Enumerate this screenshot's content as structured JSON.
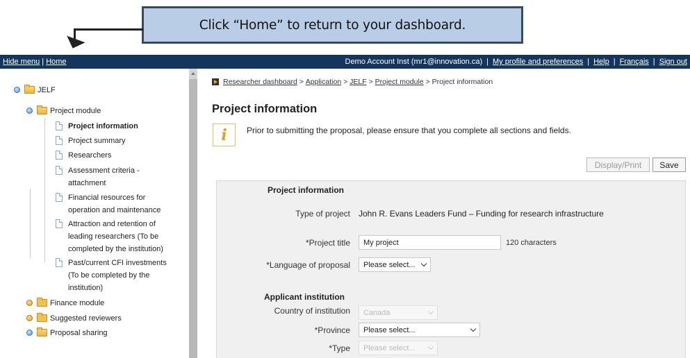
{
  "callout": {
    "text": "Click “Home” to return to your dashboard."
  },
  "topbar": {
    "hide_menu": "Hide menu",
    "divider": "|",
    "home": "Home",
    "account": "Demo Account Inst (mr1@innovation.ca)",
    "profile": "My profile and preferences",
    "help": "Help",
    "language": "Français",
    "sign_out": "Sign out"
  },
  "tree": {
    "root": "JELF",
    "project_module": "Project module",
    "items": [
      {
        "label": "Project information"
      },
      {
        "label": "Project summary"
      },
      {
        "label": "Researchers"
      },
      {
        "label_lines": [
          "Assessment criteria -",
          "attachment"
        ]
      },
      {
        "label_lines": [
          "Financial resources for",
          "operation and maintenance"
        ]
      },
      {
        "label_lines": [
          "Attraction and retention of",
          "leading researchers (To be",
          "completed by the institution)"
        ]
      },
      {
        "label_lines": [
          "Past/current CFI investments",
          "(To be completed by the",
          "institution)"
        ]
      }
    ],
    "finance_module": "Finance module",
    "suggested_reviewers": "Suggested reviewers",
    "proposal_sharing": "Proposal sharing"
  },
  "breadcrumb": {
    "items": [
      "Researcher dashboard",
      "Application",
      "JELF",
      "Project module"
    ],
    "current": "Project information",
    "separator": " > "
  },
  "page": {
    "title": "Project information",
    "info_message": "Prior to submitting the proposal, please ensure that you complete all sections and fields.",
    "display_print": "Display/Print",
    "save": "Save"
  },
  "form": {
    "section1": "Project information",
    "type_label": "Type of project",
    "type_value": "John R. Evans Leaders Fund – Funding for research infrastructure",
    "title_label": "*Project title",
    "title_value": "My project",
    "title_hint": "120 characters",
    "language_label": "*Language of proposal",
    "language_value": "Please select...",
    "section2": "Applicant institution",
    "country_label": "Country of institution",
    "country_value": "Canada",
    "province_label": "*Province",
    "province_value": "Please select...",
    "type2_label": "*Type",
    "type2_value": "Please select..."
  }
}
